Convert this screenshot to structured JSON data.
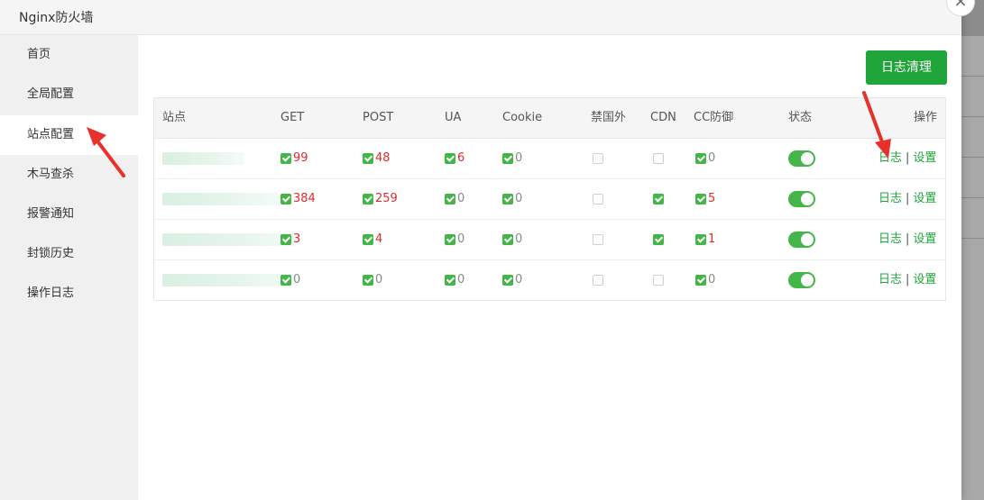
{
  "dialog": {
    "title": "Nginx防火墙",
    "close": "×"
  },
  "sidebar": {
    "items": [
      {
        "label": "首页"
      },
      {
        "label": "全局配置"
      },
      {
        "label": "站点配置"
      },
      {
        "label": "木马查杀"
      },
      {
        "label": "报警通知"
      },
      {
        "label": "封锁历史"
      },
      {
        "label": "操作日志"
      }
    ],
    "active_index": 2
  },
  "toolbar": {
    "clear_log_label": "日志清理"
  },
  "table": {
    "headers": [
      "站点",
      "GET",
      "POST",
      "UA",
      "Cookie",
      "禁国外",
      "CDN",
      "CC防御",
      "状态",
      "操作"
    ],
    "rows": [
      {
        "get": "99",
        "post": "48",
        "ua": "6",
        "cookie": "0",
        "foreign": false,
        "cdn": false,
        "cc": "0",
        "status": true
      },
      {
        "get": "384",
        "post": "259",
        "ua": "0",
        "cookie": "0",
        "foreign": false,
        "cdn": true,
        "cc": "5",
        "status": true
      },
      {
        "get": "3",
        "post": "4",
        "ua": "0",
        "cookie": "0",
        "foreign": false,
        "cdn": true,
        "cc": "1",
        "status": true
      },
      {
        "get": "0",
        "post": "0",
        "ua": "0",
        "cookie": "0",
        "foreign": false,
        "cdn": false,
        "cc": "0",
        "status": true
      }
    ],
    "ops": {
      "log": "日志",
      "sep": "|",
      "settings": "设置"
    }
  },
  "colors": {
    "accent": "#20a53a",
    "check": "#44b549",
    "alert": "#e02c2c",
    "arrow": "#e8312b"
  }
}
